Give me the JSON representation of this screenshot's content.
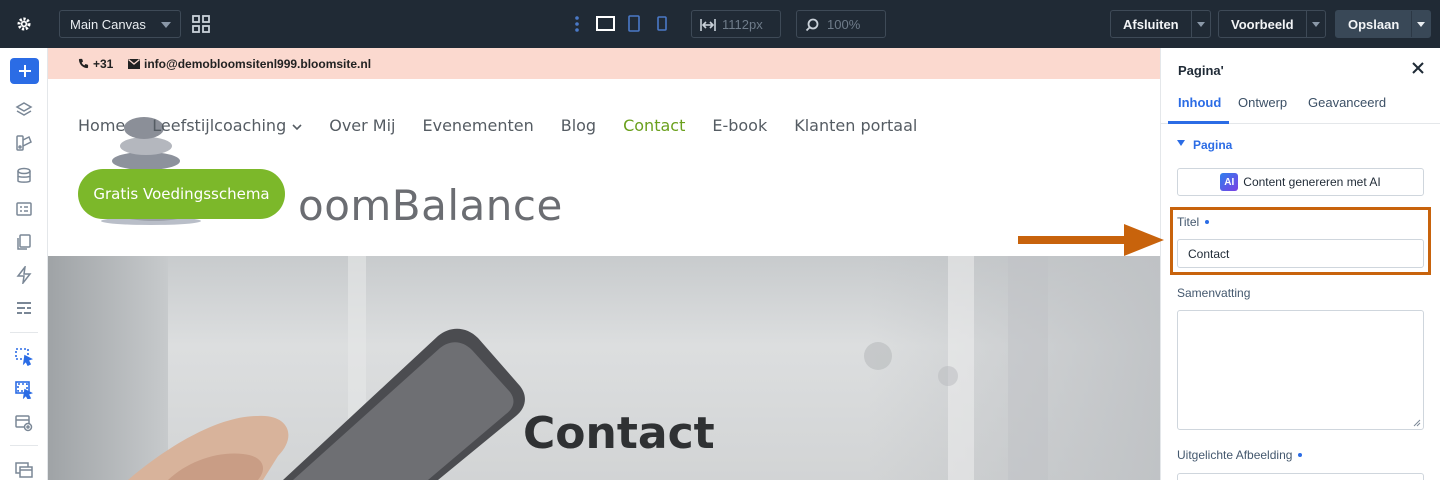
{
  "toolbar": {
    "canvas_select": "Main Canvas",
    "width_value": "1112px",
    "zoom_value": "100%",
    "close_label": "Afsluiten",
    "preview_label": "Voorbeeld",
    "save_label": "Opslaan"
  },
  "site": {
    "phone": "+31",
    "email": "info@demobloomsitenl999.bloomsite.nl",
    "logo_text": "oomBalance",
    "nav": [
      "Home",
      "Leefstijlcoaching",
      "Over Mij",
      "Evenementen",
      "Blog",
      "Contact",
      "E-book",
      "Klanten portaal"
    ],
    "nav_active": "Contact",
    "cta_label": "Gratis Voedingsschema",
    "hero_title": "Contact"
  },
  "panel": {
    "title": "Pagina'",
    "tabs": [
      "Inhoud",
      "Ontwerp",
      "Geavanceerd"
    ],
    "section": "Pagina",
    "ai_badge": "AI",
    "ai_button": "Content genereren met AI",
    "title_label": "Titel",
    "title_value": "Contact",
    "summary_label": "Samenvatting",
    "featured_label": "Uitgelichte Afbeelding"
  },
  "colors": {
    "toolbar_bg": "#202a35",
    "accent_blue": "#2b6ce5",
    "brand_green": "#7cb82a",
    "info_bar": "#fbd9cf",
    "annotation_orange": "#c8630c"
  }
}
